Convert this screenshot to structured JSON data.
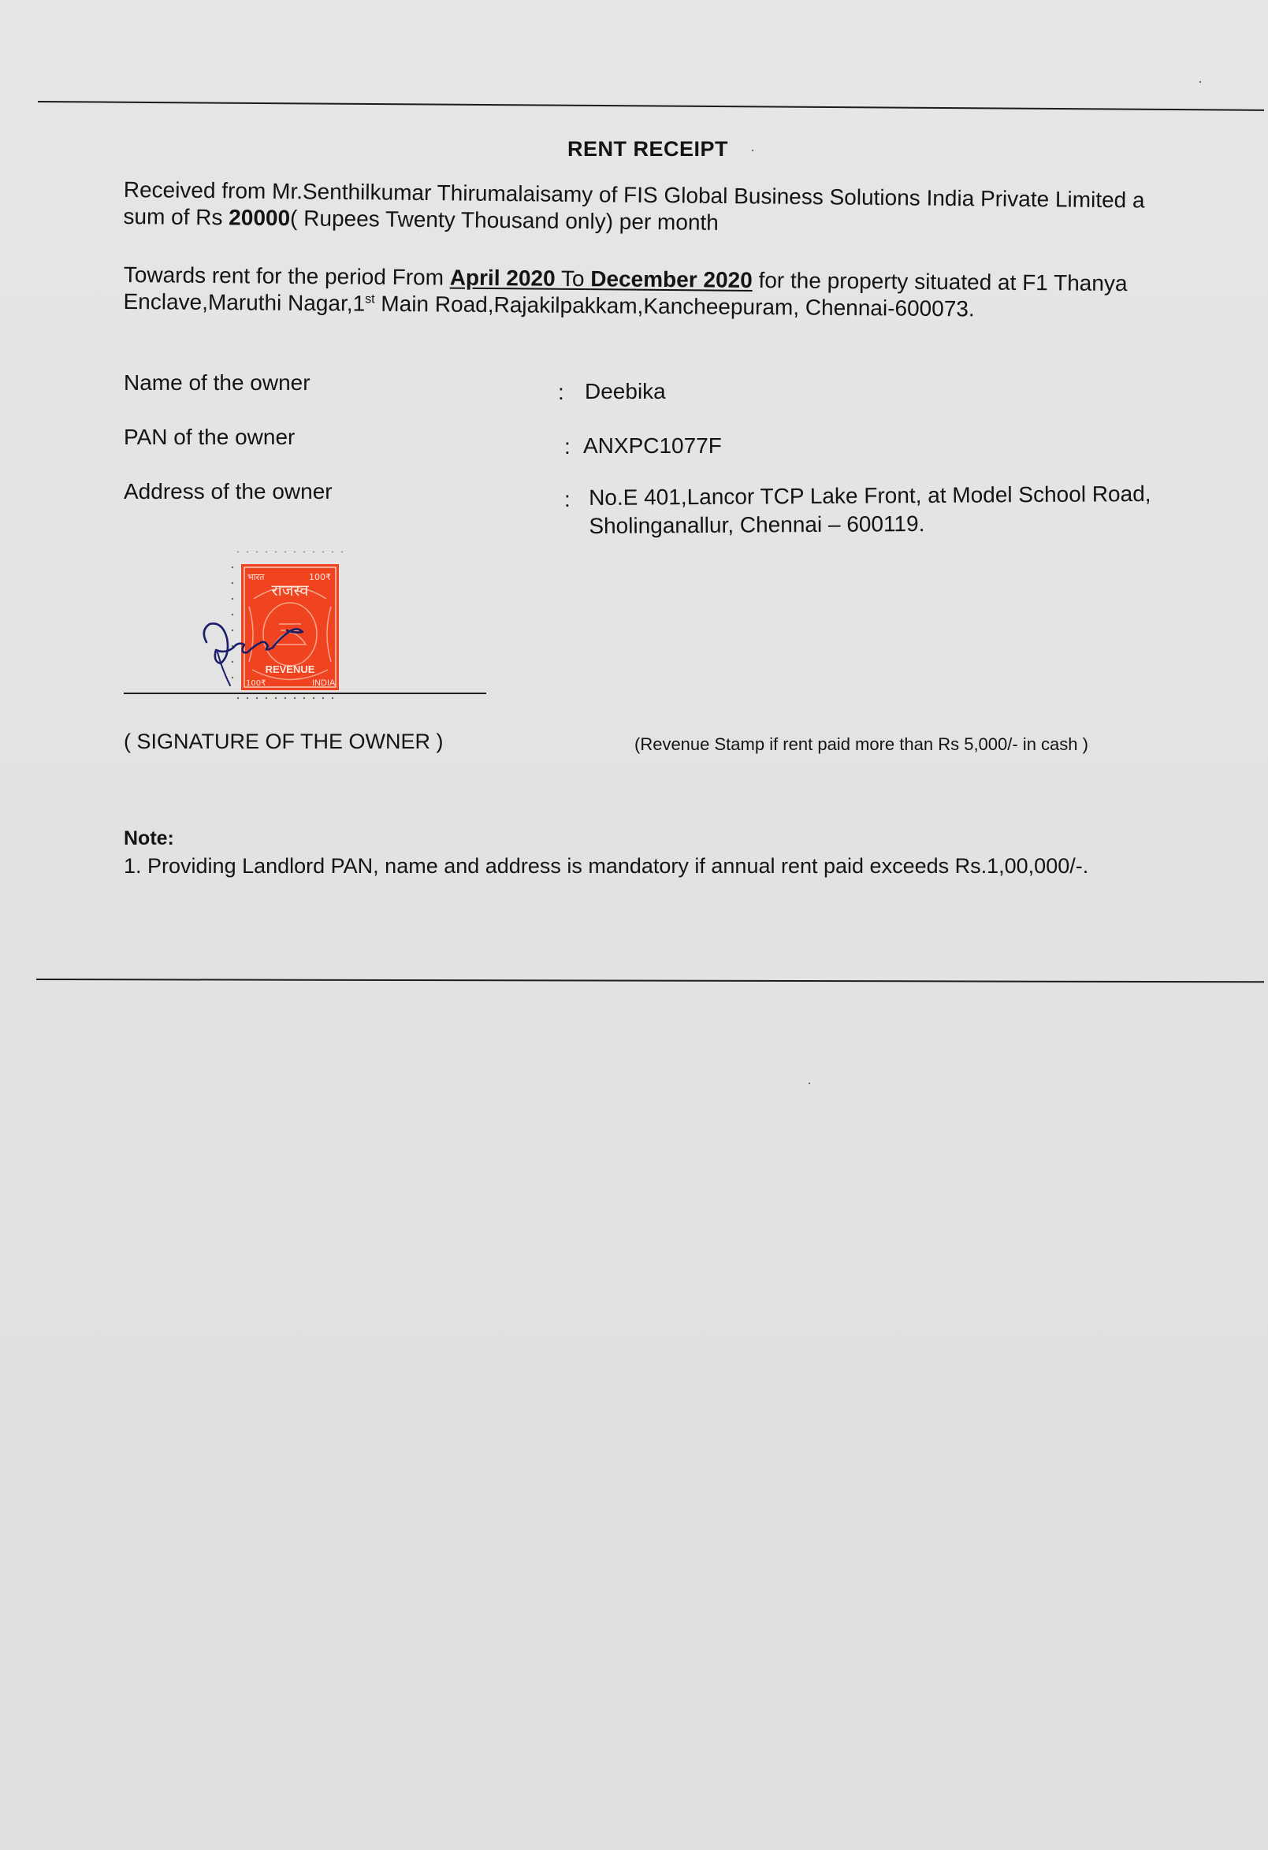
{
  "receipt": {
    "title": "RENT RECEIPT",
    "para1": {
      "line1": "Received from Mr.Senthilkumar Thirumalaisamy of FIS Global Business Solutions India Private Limited a",
      "line2_prefix": "sum of  Rs ",
      "amount": "20000",
      "line2_suffix": "( Rupees Twenty Thousand only)  per month"
    },
    "para2": {
      "prefix": "Towards rent for the period From ",
      "from": "April 2020",
      "to_word": " To ",
      "to": "December 2020",
      "suffix": " for the property situated at F1 Thanya",
      "line2_prefix": "Enclave,Maruthi Nagar,1",
      "sup": "st",
      "line2_suffix": " Main Road,Rajakilpakkam,Kancheepuram, Chennai-600073."
    },
    "fields": {
      "owner_name_label": "Name of the owner",
      "owner_name": "Deebika",
      "pan_label": "PAN of the owner",
      "pan": "ANXPC1077F",
      "address_label": "Address of the owner",
      "address_line1": "No.E 401,Lancor TCP Lake Front, at Model School Road,",
      "address_line2": "Sholinganallur, Chennai – 600119.",
      "colon": ":"
    },
    "stamp": {
      "top_left": "भारत",
      "top_right": "100₹",
      "devanagari": "राजस्व",
      "label": "REVENUE",
      "bottom_left": "100₹",
      "bottom_right": "INDIA",
      "color": "#f0431f"
    },
    "signature_caption": "( SIGNATURE OF THE OWNER )",
    "stamp_note": "(Revenue Stamp if rent paid more than Rs 5,000/- in cash )",
    "note_title": "Note:",
    "note_item": "1. Providing Landlord PAN, name and address is mandatory if annual rent paid exceeds Rs.1,00,000/-."
  }
}
